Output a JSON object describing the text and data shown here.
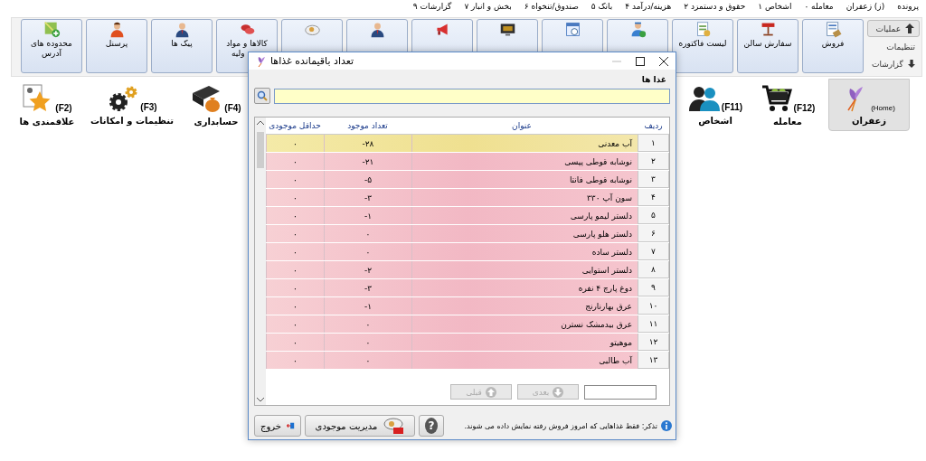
{
  "menu_bar": [
    {
      "label": "پرونده"
    },
    {
      "label": "(ز) زعفران"
    },
    {
      "label": "معامله ۰"
    },
    {
      "label": "اشخاص ۱"
    },
    {
      "label": "حقوق و دستمزد ۲"
    },
    {
      "label": "هزینه/درآمد ۴"
    },
    {
      "label": "بانک ۵"
    },
    {
      "label": "صندوق/تنخواه ۶"
    },
    {
      "label": "بخش و انبار ۷"
    },
    {
      "label": "گزارشات ۹"
    }
  ],
  "side_menu": [
    {
      "label": "عملیات",
      "selected": true,
      "kind": "up"
    },
    {
      "label": "تنظیمات",
      "selected": false,
      "kind": "none"
    },
    {
      "label": "گزارشات",
      "selected": false,
      "kind": "down"
    }
  ],
  "toolbar": [
    {
      "lines": [
        "فروش"
      ],
      "kind": "invoice"
    },
    {
      "lines": [
        "سفارش سالن"
      ],
      "kind": "table"
    },
    {
      "lines": [
        "لیست فاکتوره"
      ],
      "kind": "list"
    },
    {
      "kind": "courier"
    },
    {
      "kind": "calendar"
    },
    {
      "kind": "screen"
    },
    {
      "kind": "megaphone"
    },
    {
      "kind": "person"
    },
    {
      "kind": "plate"
    },
    {
      "lines": [
        "کالاها و مواد",
        "ولیه"
      ],
      "kind": "meat"
    },
    {
      "lines": [
        "پیک ها"
      ],
      "kind": "person"
    },
    {
      "lines": [
        "پرسنل"
      ],
      "kind": "staff"
    },
    {
      "lines": [
        "محدوده های",
        "آدرس"
      ],
      "kind": "map"
    }
  ],
  "nav": [
    {
      "label": "زعفران",
      "key": "(Home)",
      "selected": true,
      "kind": "flower"
    },
    {
      "label": "معامله",
      "key": "(F12)",
      "selected": false,
      "kind": "cart"
    },
    {
      "label": "اشخاص",
      "key": "(F11)",
      "selected": false,
      "kind": "people"
    },
    {
      "label": "حسابداری",
      "key": "(F4)",
      "selected": false,
      "kind": "book"
    },
    {
      "label": "تنظیمات و امکانات",
      "key": "(F3)",
      "selected": false,
      "kind": "gears"
    },
    {
      "label": "علاقمندی ها",
      "key": "(F2)",
      "selected": false,
      "kind": "star"
    }
  ],
  "dialog": {
    "title": "تعداد باقیمانده غذاها",
    "group_label": "غذا ها",
    "columns": [
      "ردیف",
      "عنوان",
      "تعداد موجود",
      "حداقل موجودی"
    ],
    "rows": [
      {
        "cells": [
          "۱",
          "آب معدنی",
          "-۲۸",
          "۰"
        ],
        "selected": true
      },
      {
        "cells": [
          "۲",
          "نوشابه قوطی پپسی",
          "-۲۱",
          "۰"
        ],
        "selected": false
      },
      {
        "cells": [
          "۳",
          "نوشابه قوطی فانتا",
          "-۵",
          "۰"
        ],
        "selected": false
      },
      {
        "cells": [
          "۴",
          "سون آپ ۳۳۰",
          "-۳",
          "۰"
        ],
        "selected": false
      },
      {
        "cells": [
          "۵",
          "دلستر لیمو پارسی",
          "-۱",
          "۰"
        ],
        "selected": false
      },
      {
        "cells": [
          "۶",
          "دلستر هلو پارسی",
          "۰",
          "۰"
        ],
        "selected": false
      },
      {
        "cells": [
          "۷",
          "دلستر ساده",
          "۰",
          "۰"
        ],
        "selected": false
      },
      {
        "cells": [
          "۸",
          "دلستر استوایی",
          "-۲",
          "۰"
        ],
        "selected": false
      },
      {
        "cells": [
          "۹",
          "دوغ پارچ ۴ نفره",
          "-۳",
          "۰"
        ],
        "selected": false
      },
      {
        "cells": [
          "۱۰",
          "عرق بهارنارنج",
          "-۱",
          "۰"
        ],
        "selected": false
      },
      {
        "cells": [
          "۱۱",
          "عرق بیدمشک نسترن",
          "۰",
          "۰"
        ],
        "selected": false
      },
      {
        "cells": [
          "۱۲",
          "موهیتو",
          "۰",
          "۰"
        ],
        "selected": false
      },
      {
        "cells": [
          "۱۳",
          "آب طالبی",
          "۰",
          "۰"
        ],
        "selected": false
      }
    ],
    "pager": [
      {
        "label": "بعدی",
        "kind": "down",
        "disabled": true
      },
      {
        "label": "قبلی",
        "kind": "up",
        "disabled": true
      }
    ],
    "note": "تذکر: فقط غذاهایی که امروز فروش رفته نمایش داده می شوند.",
    "buttons": [
      {
        "label": "?",
        "kind": "help"
      },
      {
        "label": "مدیریت موجودی",
        "kind": "stock"
      },
      {
        "label": "خروج",
        "kind": "exit"
      }
    ]
  }
}
